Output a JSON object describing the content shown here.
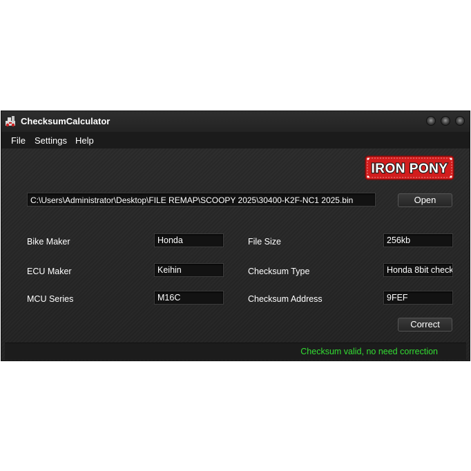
{
  "window": {
    "title": "ChecksumCalculator"
  },
  "menu": {
    "items": [
      "File",
      "Settings",
      "Help"
    ]
  },
  "logo": {
    "text": "IRON PONY"
  },
  "file": {
    "path": "C:\\Users\\Administrator\\Desktop\\FILE REMAP\\SCOOPY 2025\\30400-K2F-NC1 2025.bin",
    "open_label": "Open"
  },
  "info": {
    "bike_maker_label": "Bike Maker",
    "bike_maker_value": "Honda",
    "ecu_maker_label": "ECU Maker",
    "ecu_maker_value": "Keihin",
    "mcu_series_label": "MCU Series",
    "mcu_series_value": "M16C",
    "file_size_label": "File Size",
    "file_size_value": "256kb",
    "checksum_type_label": "Checksum Type",
    "checksum_type_value": "Honda 8bit check",
    "checksum_address_label": "Checksum Address",
    "checksum_address_value": "9FEF"
  },
  "actions": {
    "correct_label": "Correct"
  },
  "status": {
    "message": "Checksum valid, no need correction",
    "color": "#33dd33"
  }
}
